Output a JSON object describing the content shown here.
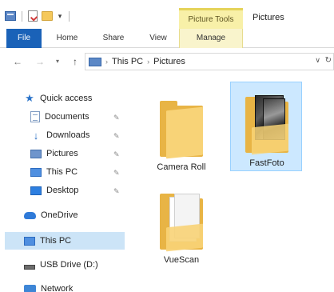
{
  "window": {
    "title": "Pictures"
  },
  "ribbon": {
    "context_group": "Picture Tools",
    "tabs": [
      {
        "label": "File"
      },
      {
        "label": "Home"
      },
      {
        "label": "Share"
      },
      {
        "label": "View"
      },
      {
        "label": "Manage"
      }
    ]
  },
  "address": {
    "breadcrumbs": [
      "This PC",
      "Pictures"
    ]
  },
  "nav": {
    "quick_access": "Quick access",
    "items": [
      {
        "label": "Documents",
        "pinned": true
      },
      {
        "label": "Downloads",
        "pinned": true
      },
      {
        "label": "Pictures",
        "pinned": true
      },
      {
        "label": "This PC",
        "pinned": true
      },
      {
        "label": "Desktop",
        "pinned": true
      }
    ],
    "onedrive": "OneDrive",
    "this_pc": "This PC",
    "usb": "USB Drive (D:)",
    "network": "Network"
  },
  "content": {
    "folders": [
      {
        "name": "Camera Roll"
      },
      {
        "name": "FastFoto",
        "selected": true
      },
      {
        "name": "VueScan"
      }
    ]
  },
  "colors": {
    "file_tab": "#1a62b8",
    "context_tab": "#f8f0a8",
    "selection": "#cce8ff",
    "folder": "#f8d377"
  },
  "icons": {
    "pin": "pin-icon",
    "quick_access": "star-icon",
    "back": "arrow-left-icon",
    "forward": "arrow-right-icon",
    "up": "arrow-up-icon"
  }
}
